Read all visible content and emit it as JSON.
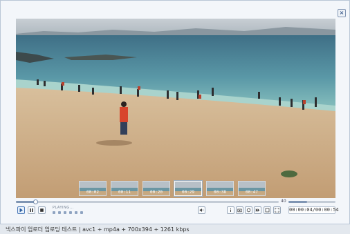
{
  "player": {
    "close_glyph": "×",
    "status_text": "PLAYING...",
    "time_display": "00:00:04/00:00:54",
    "volume_label": "40",
    "progress": 0.074,
    "volume": 0.4
  },
  "thumbnails": [
    {
      "label": "00:02",
      "active": false
    },
    {
      "label": "00:11",
      "active": false
    },
    {
      "label": "00:20",
      "active": false
    },
    {
      "label": "00:29",
      "active": true
    },
    {
      "label": "00:38",
      "active": false
    },
    {
      "label": "00:47",
      "active": false
    }
  ],
  "controls_left": [
    {
      "name": "play-button",
      "icon": "play-icon",
      "active": true
    },
    {
      "name": "pause-button",
      "icon": "pause-icon",
      "active": false
    },
    {
      "name": "stop-button",
      "icon": "stop-icon",
      "active": false
    }
  ],
  "controls_right": [
    {
      "name": "info-button",
      "icon": "info-icon"
    },
    {
      "name": "capture-button",
      "icon": "camera-icon"
    },
    {
      "name": "repeat-button",
      "icon": "repeat-icon"
    },
    {
      "name": "next-button",
      "icon": "next-icon"
    },
    {
      "name": "window-button",
      "icon": "window-icon"
    },
    {
      "name": "fullscreen-button",
      "icon": "fullscreen-icon"
    }
  ],
  "status_bar": {
    "text": "넥스파이 업로더 업로딩 테스트 | avc1 + mp4a + 700x394 + 1261 kbps"
  },
  "colors": {
    "accent": "#4a78b8",
    "frame_border": "#b9c6d6",
    "sand": "#c9a57e",
    "sea": "#5f9aa8"
  }
}
